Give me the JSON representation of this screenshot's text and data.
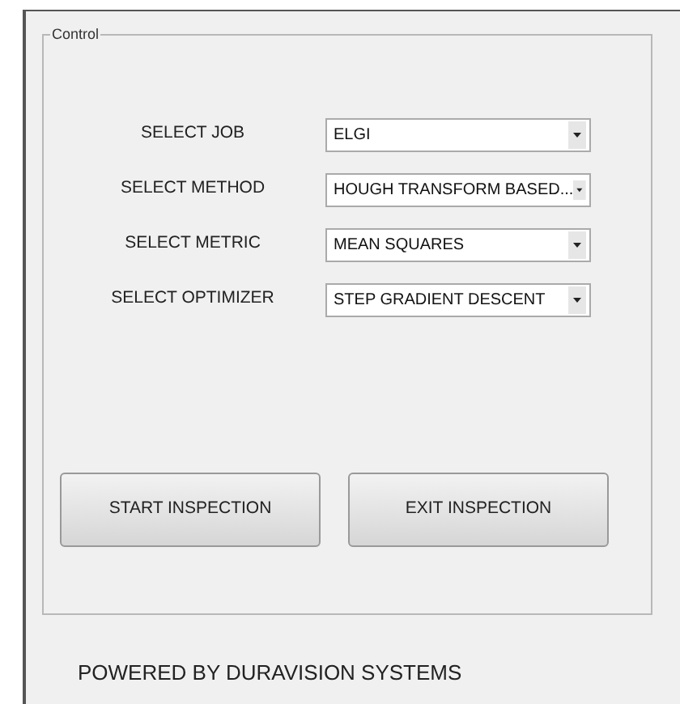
{
  "panel": {
    "title": "Control"
  },
  "fields": [
    {
      "label": "SELECT JOB",
      "value": "ELGI"
    },
    {
      "label": "SELECT METHOD",
      "value": "HOUGH TRANSFORM BASED..."
    },
    {
      "label": "SELECT METRIC",
      "value": "MEAN SQUARES"
    },
    {
      "label": "SELECT OPTIMIZER",
      "value": "STEP GRADIENT DESCENT"
    }
  ],
  "buttons": [
    "START INSPECTION",
    "EXIT INSPECTION"
  ],
  "footer": "POWERED BY DURAVISION SYSTEMS"
}
